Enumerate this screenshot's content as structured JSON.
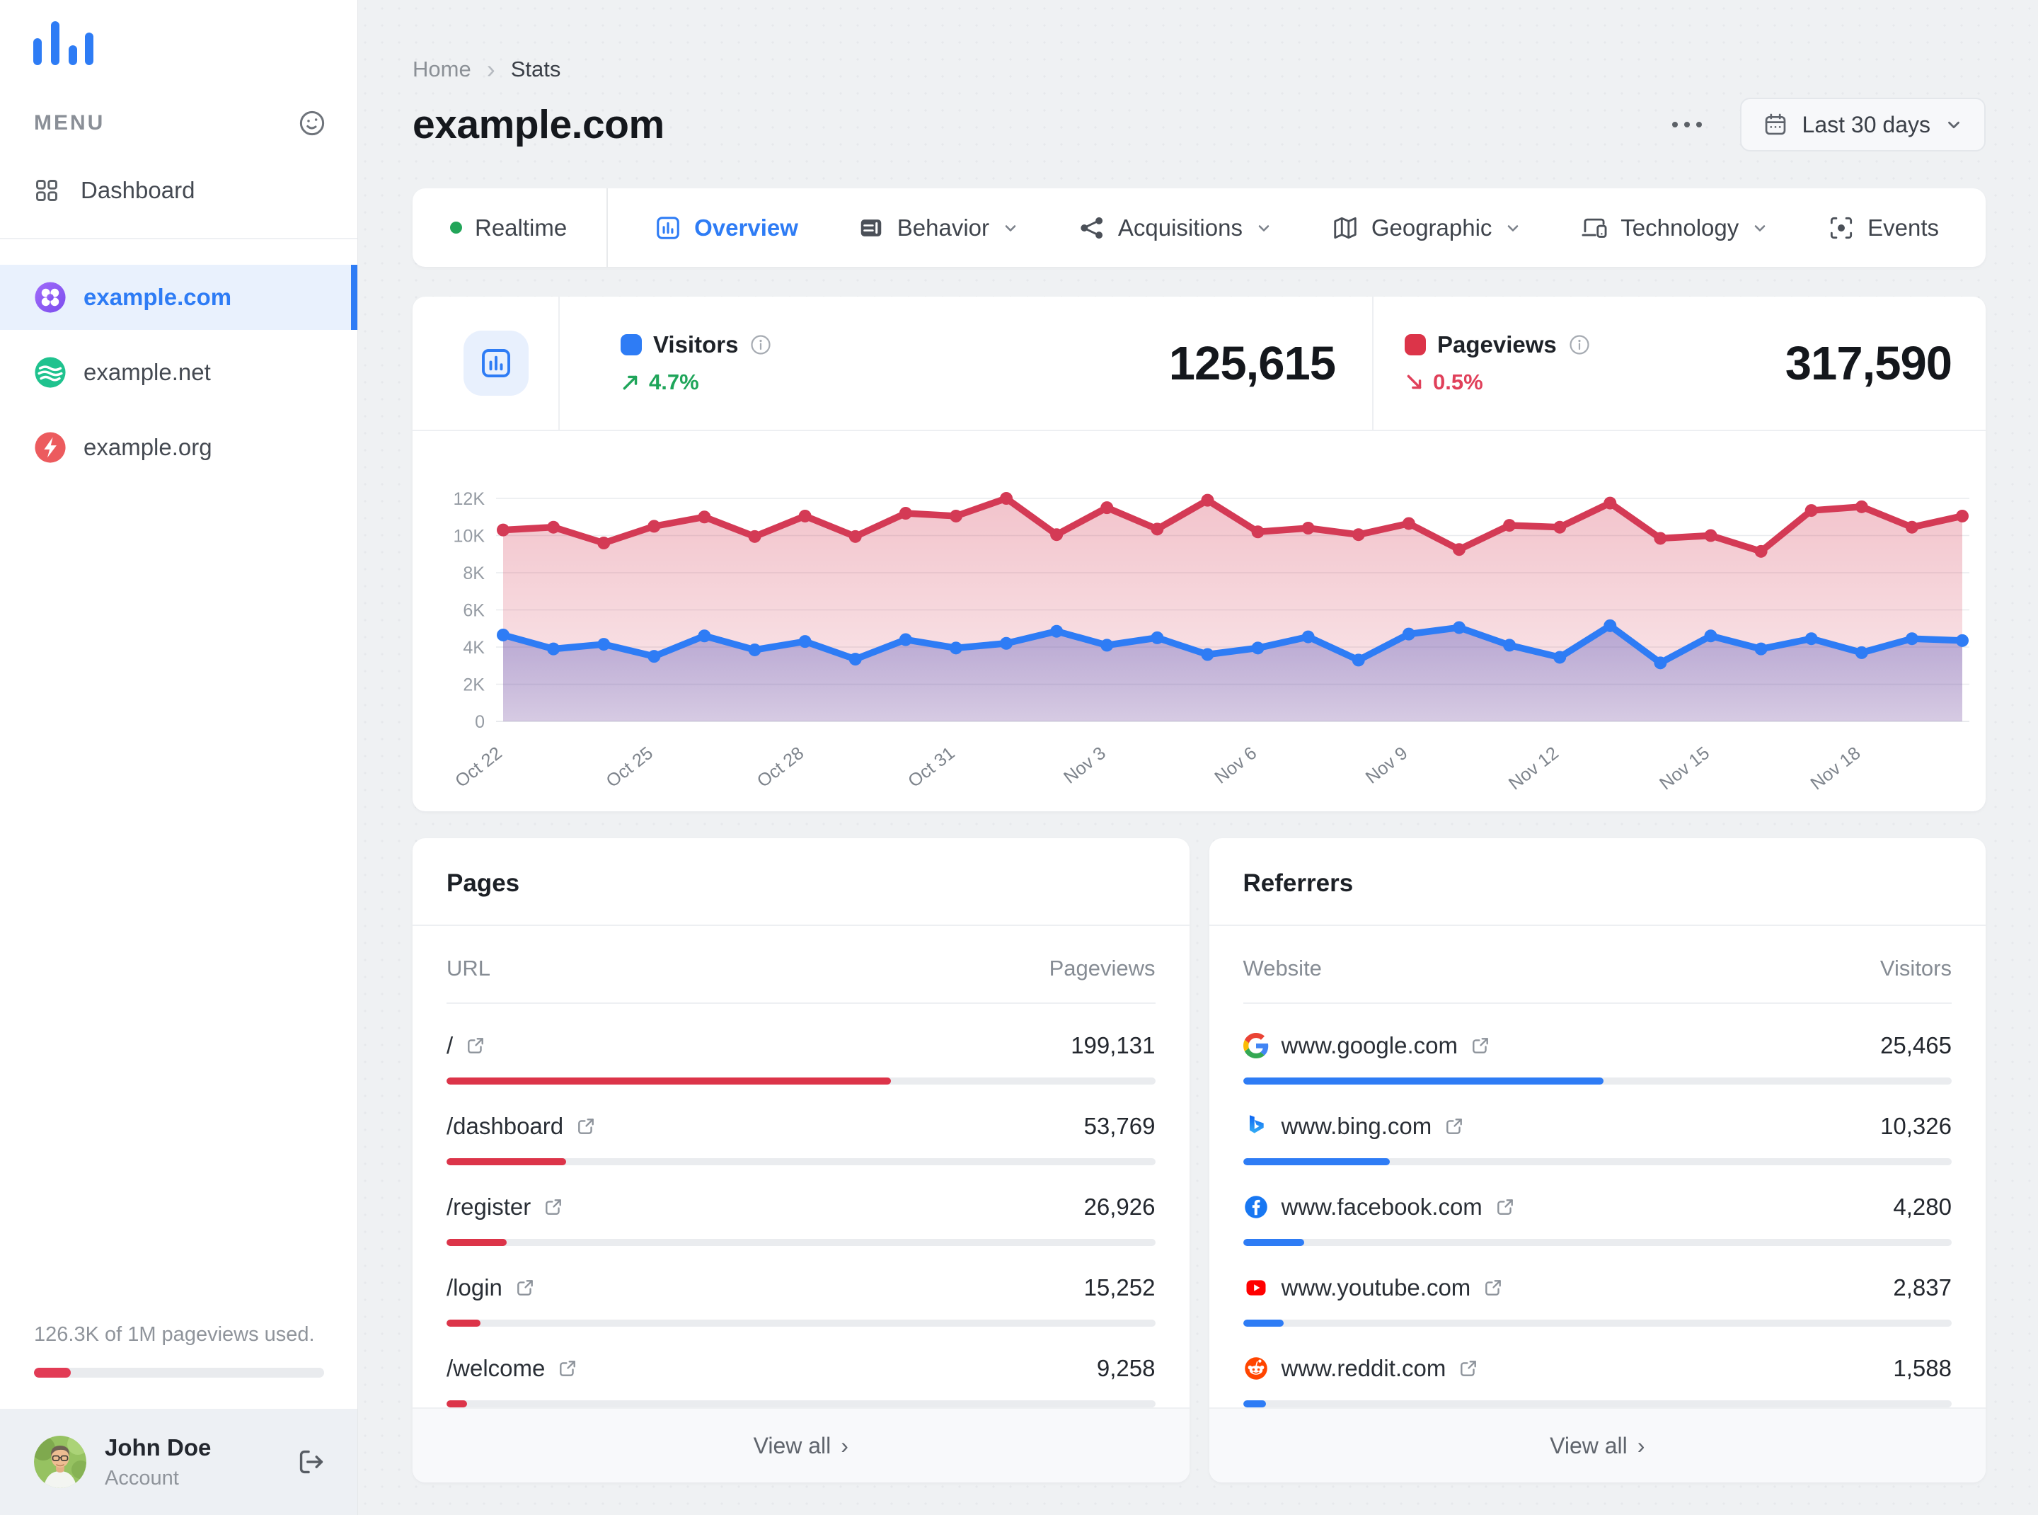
{
  "colors": {
    "accent_blue": "#2e7cf5",
    "accent_red": "#dc3449",
    "accent_green": "#1fa55a",
    "page_bg": "#eff1f3"
  },
  "sidebar": {
    "menu_label": "MENU",
    "nav": {
      "dashboard": "Dashboard"
    },
    "sites": [
      {
        "label": "example.com",
        "active": true
      },
      {
        "label": "example.net",
        "active": false
      },
      {
        "label": "example.org",
        "active": false
      }
    ],
    "usage": {
      "text": "126.3K of 1M pageviews used.",
      "percent": 12.6
    },
    "user": {
      "name": "John Doe",
      "role": "Account"
    }
  },
  "header": {
    "breadcrumb": {
      "home": "Home",
      "current": "Stats"
    },
    "title": "example.com",
    "date_button": "Last 30 days"
  },
  "tabs": {
    "realtime": "Realtime",
    "overview": "Overview",
    "behavior": "Behavior",
    "acquisitions": "Acquisitions",
    "geographic": "Geographic",
    "technology": "Technology",
    "events": "Events"
  },
  "stats": {
    "visitors": {
      "label": "Visitors",
      "trend": "4.7%",
      "direction": "up",
      "value": "125,615"
    },
    "pageviews": {
      "label": "Pageviews",
      "trend": "0.5%",
      "direction": "down",
      "value": "317,590"
    }
  },
  "chart_data": {
    "type": "line",
    "title": "",
    "xlabel": "",
    "ylabel": "",
    "ylim": [
      0,
      12000
    ],
    "yticks": [
      "0",
      "2K",
      "4K",
      "6K",
      "8K",
      "10K",
      "12K"
    ],
    "grid": true,
    "legend_position": "none",
    "tick_every": 3,
    "x": [
      "Oct 22",
      "Oct 23",
      "Oct 24",
      "Oct 25",
      "Oct 26",
      "Oct 27",
      "Oct 28",
      "Oct 29",
      "Oct 30",
      "Oct 31",
      "Nov 1",
      "Nov 2",
      "Nov 3",
      "Nov 4",
      "Nov 5",
      "Nov 6",
      "Nov 7",
      "Nov 8",
      "Nov 9",
      "Nov 10",
      "Nov 11",
      "Nov 12",
      "Nov 13",
      "Nov 14",
      "Nov 15",
      "Nov 16",
      "Nov 17",
      "Nov 18",
      "Nov 19",
      "Nov 20"
    ],
    "series": [
      {
        "name": "Pageviews",
        "color": "#d43a55",
        "fill_from": "rgba(212,58,85,0.30)",
        "fill_to": "rgba(212,58,85,0.10)",
        "values": [
          10300,
          10450,
          9600,
          10500,
          11000,
          9950,
          11050,
          9950,
          11200,
          11050,
          12000,
          10050,
          11500,
          10350,
          11900,
          10200,
          10400,
          10050,
          10650,
          9250,
          10550,
          10450,
          11750,
          9850,
          10000,
          9150,
          11350,
          11550,
          10450,
          11050
        ]
      },
      {
        "name": "Visitors",
        "color": "#2e7cf5",
        "fill_from": "rgba(86,88,190,0.40)",
        "fill_to": "rgba(86,88,190,0.22)",
        "values": [
          4650,
          3900,
          4150,
          3500,
          4600,
          3850,
          4300,
          3350,
          4400,
          3950,
          4200,
          4850,
          4100,
          4500,
          3600,
          3950,
          4550,
          3300,
          4700,
          5050,
          4100,
          3450,
          5150,
          3150,
          4600,
          3900,
          4450,
          3700,
          4450,
          4350
        ]
      }
    ]
  },
  "pages": {
    "title": "Pages",
    "col_label": "URL",
    "col_value": "Pageviews",
    "footer": "View all",
    "rows": [
      {
        "url": "/",
        "value": "199,131",
        "percent": 62.7
      },
      {
        "url": "/dashboard",
        "value": "53,769",
        "percent": 16.9
      },
      {
        "url": "/register",
        "value": "26,926",
        "percent": 8.5
      },
      {
        "url": "/login",
        "value": "15,252",
        "percent": 4.8
      },
      {
        "url": "/welcome",
        "value": "9,258",
        "percent": 2.9
      }
    ]
  },
  "referrers": {
    "title": "Referrers",
    "col_label": "Website",
    "col_value": "Visitors",
    "footer": "View all",
    "rows": [
      {
        "site": "www.google.com",
        "icon": "google-icon",
        "value": "25,465",
        "percent": 50.9
      },
      {
        "site": "www.bing.com",
        "icon": "bing-icon",
        "value": "10,326",
        "percent": 20.7
      },
      {
        "site": "www.facebook.com",
        "icon": "facebook-icon",
        "value": "4,280",
        "percent": 8.6
      },
      {
        "site": "www.youtube.com",
        "icon": "youtube-icon",
        "value": "2,837",
        "percent": 5.7
      },
      {
        "site": "www.reddit.com",
        "icon": "reddit-icon",
        "value": "1,588",
        "percent": 3.2
      }
    ]
  }
}
